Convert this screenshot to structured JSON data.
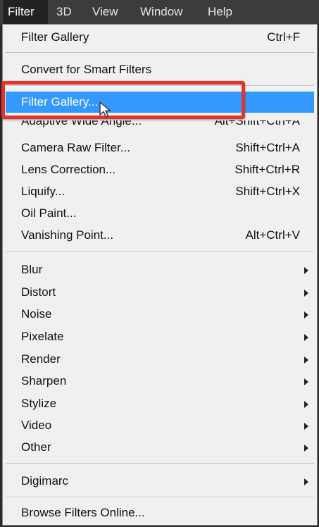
{
  "menubar": {
    "items": [
      {
        "label": "Filter"
      },
      {
        "label": "3D"
      },
      {
        "label": "View"
      },
      {
        "label": "Window"
      },
      {
        "label": "Help"
      }
    ]
  },
  "menu": {
    "last_filter": {
      "label": "Filter Gallery",
      "shortcut": "Ctrl+F"
    },
    "convert": {
      "label": "Convert for Smart Filters"
    },
    "filter_gallery": {
      "label": "Filter Gallery..."
    },
    "adaptive": {
      "label": "Adaptive Wide Angle...",
      "shortcut": "Alt+Shift+Ctrl+A"
    },
    "camera_raw": {
      "label": "Camera Raw Filter...",
      "shortcut": "Shift+Ctrl+A"
    },
    "lens": {
      "label": "Lens Correction...",
      "shortcut": "Shift+Ctrl+R"
    },
    "liquify": {
      "label": "Liquify...",
      "shortcut": "Shift+Ctrl+X"
    },
    "oil": {
      "label": "Oil Paint..."
    },
    "vanishing": {
      "label": "Vanishing Point...",
      "shortcut": "Alt+Ctrl+V"
    },
    "submenus": [
      {
        "label": "Blur"
      },
      {
        "label": "Distort"
      },
      {
        "label": "Noise"
      },
      {
        "label": "Pixelate"
      },
      {
        "label": "Render"
      },
      {
        "label": "Sharpen"
      },
      {
        "label": "Stylize"
      },
      {
        "label": "Video"
      },
      {
        "label": "Other"
      }
    ],
    "digimarc": {
      "label": "Digimarc"
    },
    "browse": {
      "label": "Browse Filters Online..."
    }
  },
  "colors": {
    "highlight": "#3399ff",
    "callout": "#e53228",
    "menubar": "#3c3c3c",
    "menu_bg": "#f0f0f0"
  },
  "icons": {
    "submenu": "chevron-right-icon",
    "pointer": "mouse-cursor-icon"
  }
}
